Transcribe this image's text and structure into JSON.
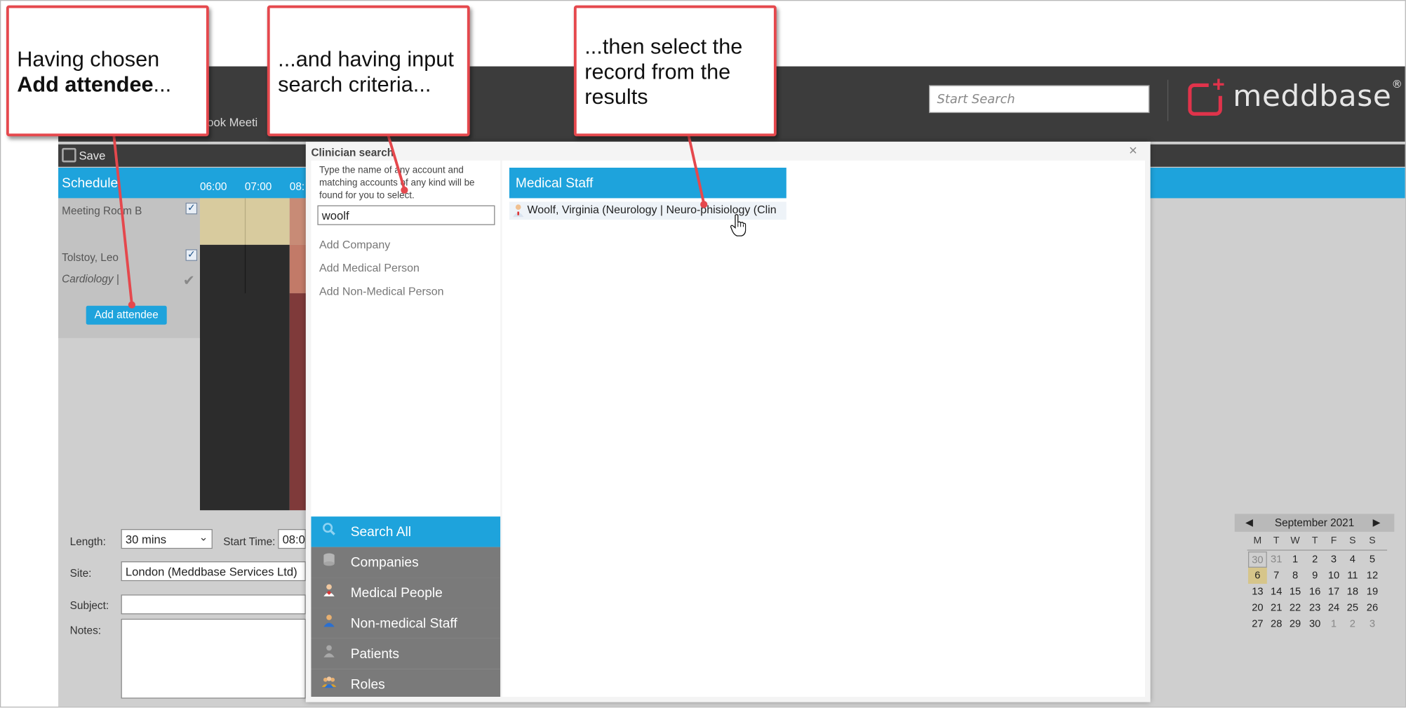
{
  "callouts": {
    "one_line1": "Having chosen",
    "one_bold": "Add attendee",
    "one_rest": "...",
    "two_line1": "...and having input",
    "two_line2": "search criteria...",
    "three_line1": "...then select the",
    "three_line2": "record from the",
    "three_line3": "results"
  },
  "header": {
    "search_placeholder": "Start Search",
    "logo_text": "meddbase",
    "logo_reg": "®",
    "tab_text": "ook Meeti"
  },
  "toolbar": {
    "save_label": "Save"
  },
  "schedule": {
    "title": "Schedule",
    "times": [
      "06:00",
      "07:00",
      "08:"
    ],
    "rows": {
      "room": "Meeting Room B",
      "person": "Tolstoy, Leo",
      "specialty": "Cardiology  |"
    },
    "add_attendee": "Add attendee"
  },
  "form": {
    "length_label": "Length:",
    "length_value": "30 mins",
    "start_label": "Start Time:",
    "start_value": "08:0",
    "site_label": "Site:",
    "site_value": "London (Meddbase Services Ltd)",
    "subject_label": "Subject:",
    "notes_label": "Notes:"
  },
  "dialog": {
    "title": "Clinician search",
    "close": "×",
    "hint": "Type the name of any account and matching accounts of any kind will be found for you to select.",
    "search_value": "woolf",
    "add_links": [
      "Add Company",
      "Add Medical Person",
      "Add Non-Medical Person"
    ],
    "categories": [
      {
        "label": "Search All",
        "icon": "search-icon",
        "active": true
      },
      {
        "label": "Companies",
        "icon": "database-icon",
        "active": false
      },
      {
        "label": "Medical People",
        "icon": "doctor-icon",
        "active": false
      },
      {
        "label": "Non-medical Staff",
        "icon": "staff-icon",
        "active": false
      },
      {
        "label": "Patients",
        "icon": "person-icon",
        "active": false
      },
      {
        "label": "Roles",
        "icon": "group-icon",
        "active": false
      }
    ],
    "results_header": "Medical Staff",
    "result_text": "Woolf, Virginia (Neurology | Neuro-phisiology (Clin"
  },
  "calendar": {
    "month": "September 2021",
    "prev": "◀",
    "next": "▶",
    "dow": [
      "M",
      "T",
      "W",
      "T",
      "F",
      "S",
      "S"
    ],
    "weeks": [
      [
        "30",
        "31",
        "1",
        "2",
        "3",
        "4",
        "5"
      ],
      [
        "6",
        "7",
        "8",
        "9",
        "10",
        "11",
        "12"
      ],
      [
        "13",
        "14",
        "15",
        "16",
        "17",
        "18",
        "19"
      ],
      [
        "20",
        "21",
        "22",
        "23",
        "24",
        "25",
        "26"
      ],
      [
        "27",
        "28",
        "29",
        "30",
        "1",
        "2",
        "3"
      ]
    ],
    "selected_day": "6",
    "colors": {
      "accent": "#1ea3dc",
      "today": "#d6c58a",
      "callout_border": "#e5484d",
      "logo": "#e0334b"
    }
  }
}
